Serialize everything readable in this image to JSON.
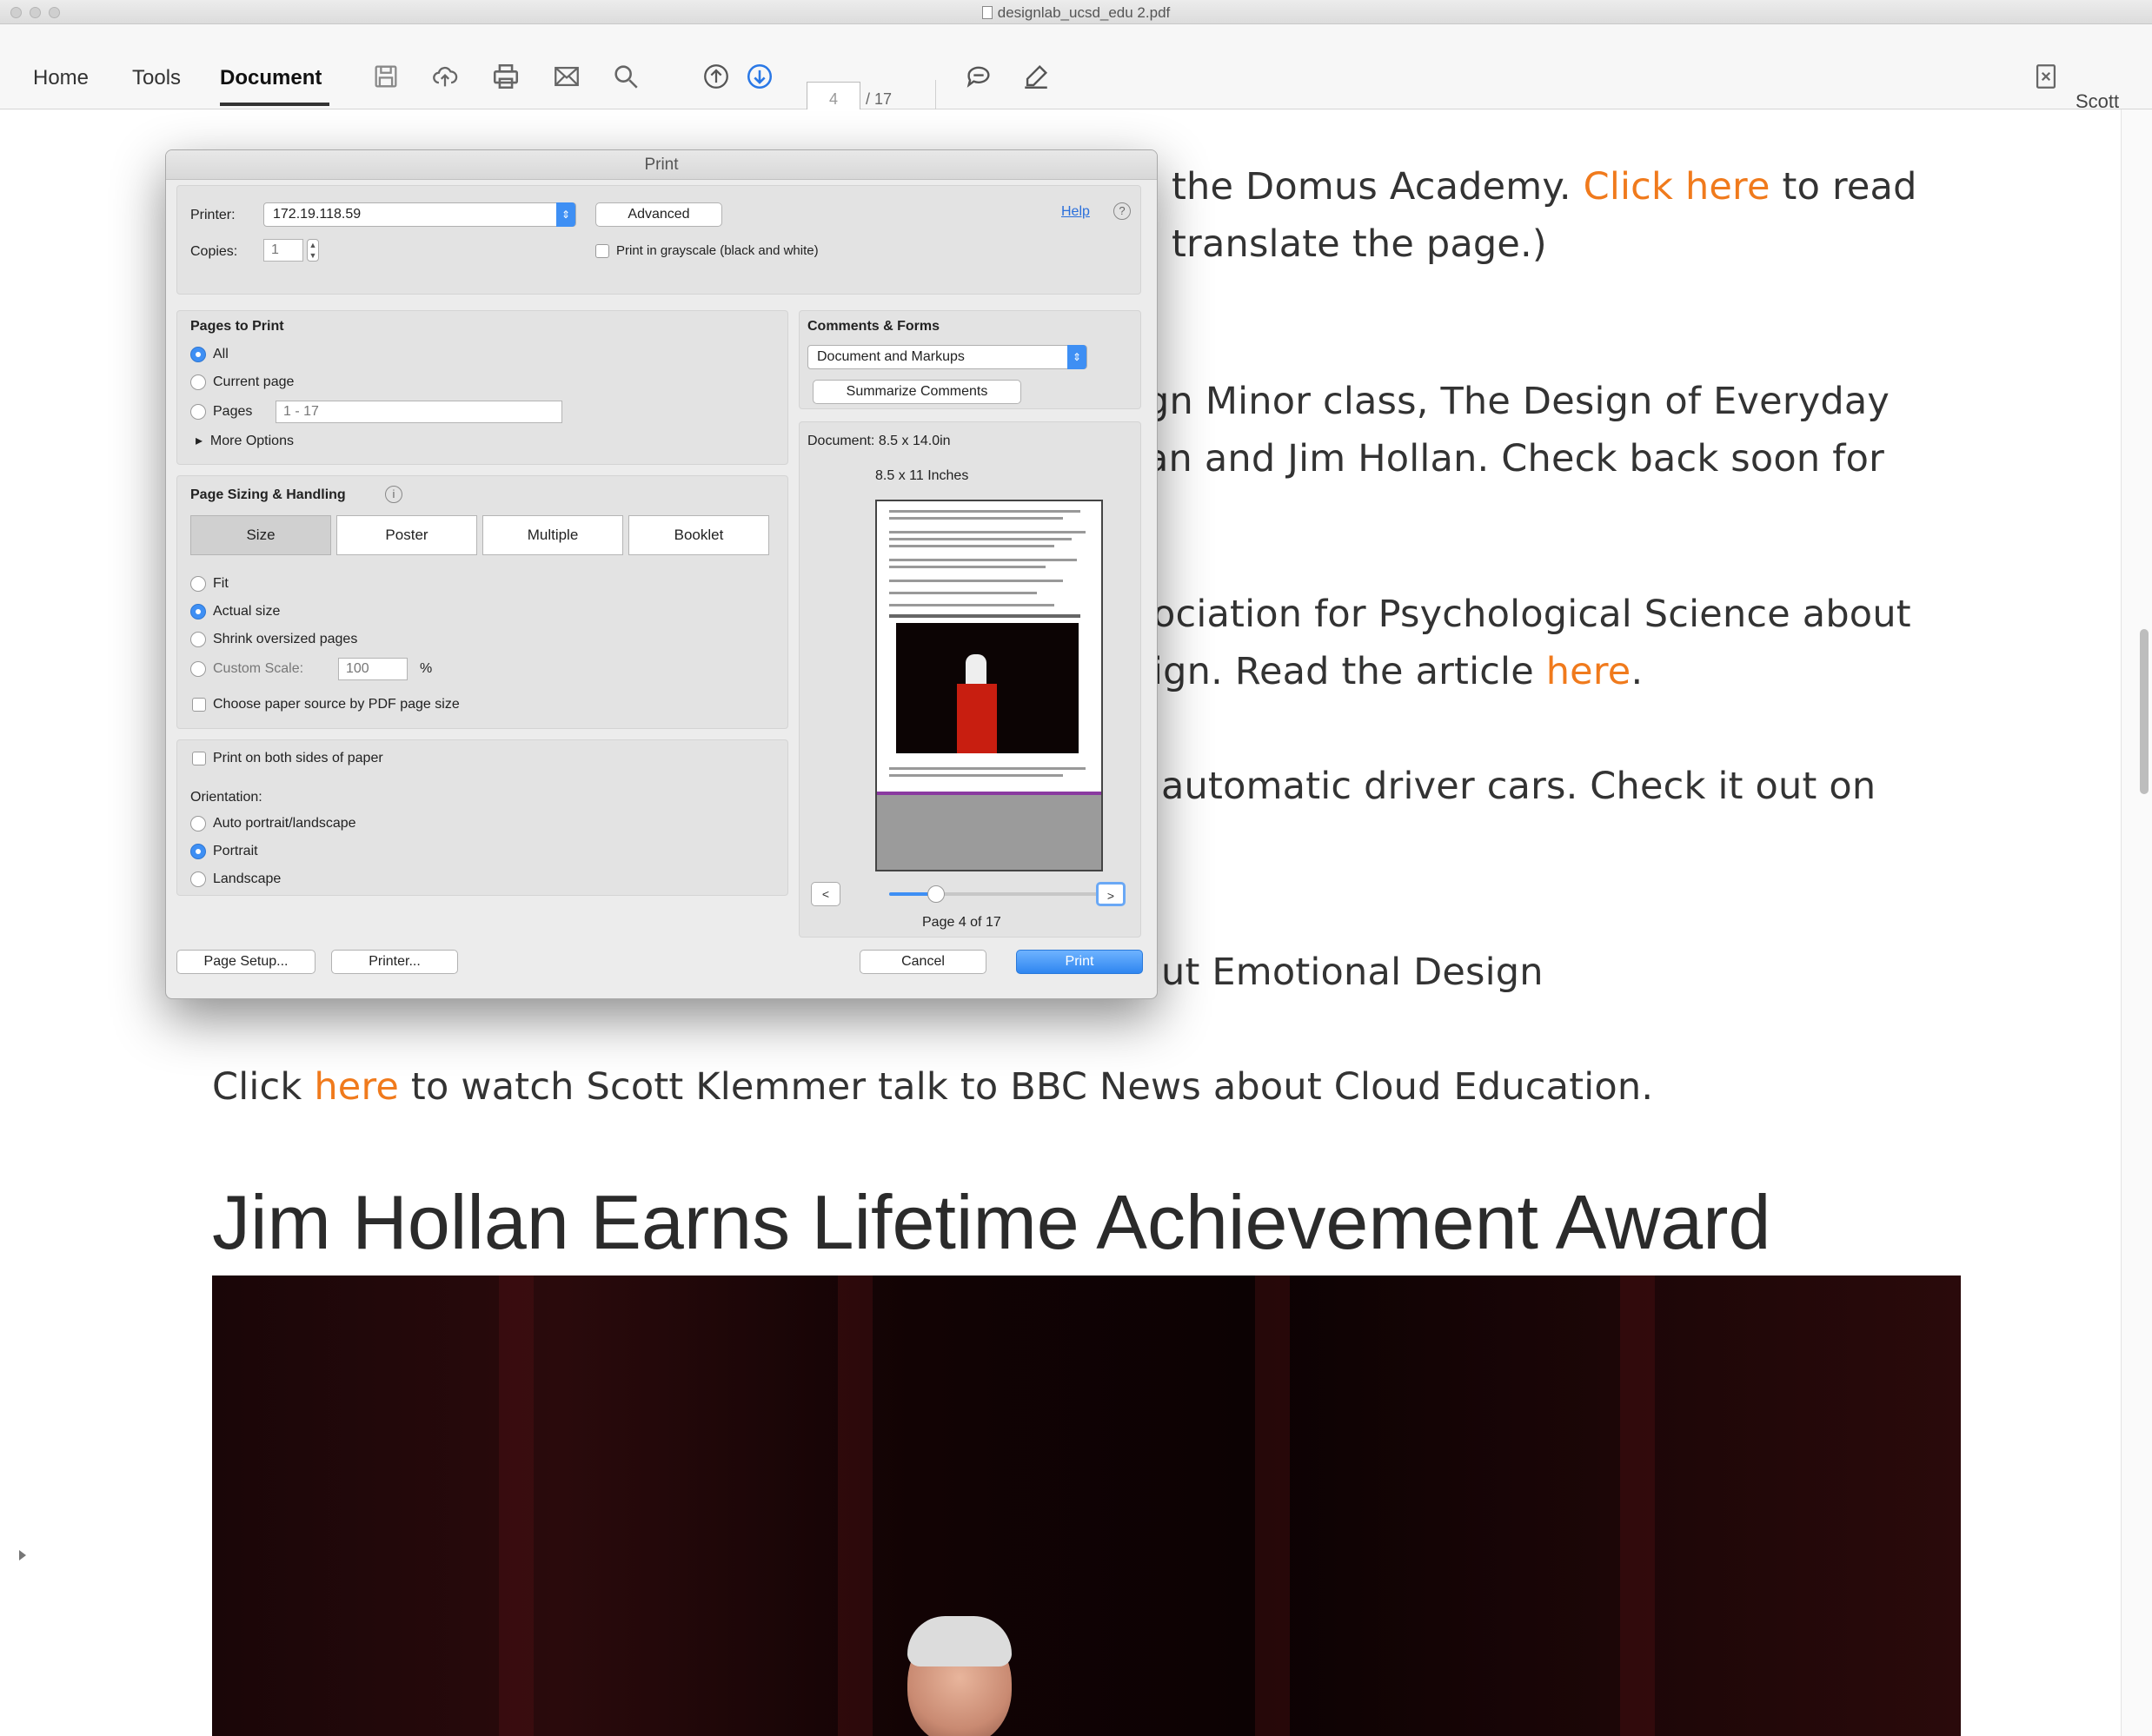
{
  "window": {
    "title": "designlab_ucsd_edu 2.pdf"
  },
  "toolbar": {
    "tabs": [
      "Home",
      "Tools",
      "Document"
    ],
    "active_tab": "Document",
    "page_current": "4",
    "page_total": "/ 17",
    "user": "Scott"
  },
  "doc": {
    "lines": [
      {
        "pre": "the Domus Academy. ",
        "link": "Click here",
        "post": " to read"
      },
      {
        "pre": "translate the page.)",
        "link": "",
        "post": ""
      },
      {
        "pre": "gn Minor class, The Design of Everyday",
        "link": "",
        "post": ""
      },
      {
        "pre": "an and Jim Hollan. Check back soon for",
        "link": "",
        "post": ""
      },
      {
        "pre": "ociation for Psychological Science about",
        "link": "",
        "post": ""
      },
      {
        "pre": "ign. Read the article ",
        "link": "here",
        "post": "."
      },
      {
        "pre": "automatic driver cars. Check it out on",
        "link": "",
        "post": ""
      },
      {
        "pre": "ut Emotional Design",
        "link": "",
        "post": ""
      },
      {
        "pre": "Click ",
        "link": "here",
        "post": " to watch Scott Klemmer talk to BBC News about Cloud Education."
      }
    ],
    "headline": "Jim Hollan Earns Lifetime Achievement Award"
  },
  "print_dialog": {
    "title": "Print",
    "printer_label": "Printer:",
    "printer_value": "172.19.118.59",
    "advanced_label": "Advanced",
    "help_label": "Help",
    "copies_label": "Copies:",
    "copies_value": "1",
    "grayscale_label": "Print in grayscale (black and white)",
    "pages_heading": "Pages to Print",
    "pages_options": [
      "All",
      "Current page",
      "Pages"
    ],
    "pages_range": "1 - 17",
    "more_options": "More Options",
    "sizing_heading": "Page Sizing & Handling",
    "sizing_tabs": [
      "Size",
      "Poster",
      "Multiple",
      "Booklet"
    ],
    "size_options": [
      "Fit",
      "Actual size",
      "Shrink oversized pages",
      "Custom Scale:"
    ],
    "custom_scale_value": "100",
    "custom_scale_unit": "%",
    "paper_source_label": "Choose paper source by PDF page size",
    "both_sides_label": "Print on both sides of paper",
    "orientation_label": "Orientation:",
    "orientation_options": [
      "Auto portrait/landscape",
      "Portrait",
      "Landscape"
    ],
    "comments_heading": "Comments & Forms",
    "comments_value": "Document and Markups",
    "summarize_label": "Summarize Comments",
    "document_size": "Document: 8.5 x 14.0in",
    "paper_size": "8.5 x 11 Inches",
    "page_of": "Page 4 of 17",
    "prev_label": "<",
    "next_label": ">",
    "page_setup_label": "Page Setup...",
    "printer_button_label": "Printer...",
    "cancel_label": "Cancel",
    "print_label": "Print"
  },
  "colors": {
    "link": "#f07a1c",
    "accent": "#3e8ff4"
  }
}
